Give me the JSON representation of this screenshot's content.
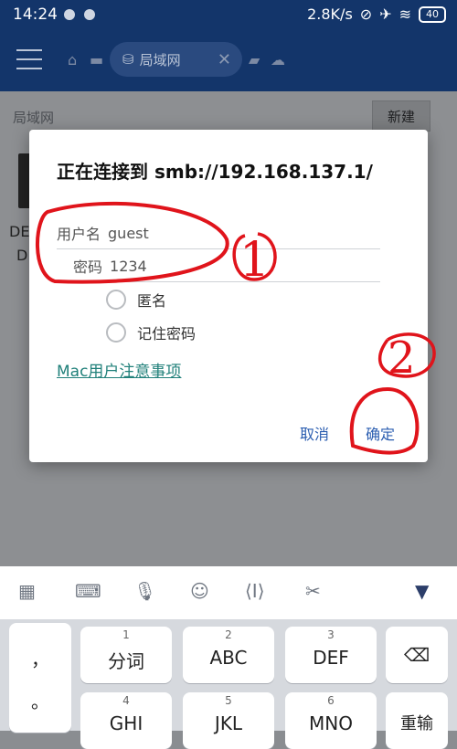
{
  "status_bar": {
    "time": "14:24",
    "network_speed": "2.8K/s",
    "battery_level": "40"
  },
  "header": {
    "tab_label": "局域网"
  },
  "page": {
    "breadcrumb": "局域网",
    "new_button": "新建",
    "bg_text_1": "DE",
    "bg_text_2": "D"
  },
  "dialog": {
    "title": "正在连接到 smb://192.168.137.1/",
    "username_label": "用户名",
    "username_value": "guest",
    "password_label": "密码",
    "password_value": "1234",
    "anonymous_label": "匿名",
    "remember_label": "记住密码",
    "mac_link": "Mac用户注意事项",
    "cancel_label": "取消",
    "ok_label": "确定"
  },
  "annotations": {
    "mark_1": "1",
    "mark_2": "2",
    "color": "#e0141b"
  },
  "keyboard": {
    "side_keys": [
      "，",
      "。"
    ],
    "keys_row1": [
      {
        "num": "1",
        "main": "分词"
      },
      {
        "num": "2",
        "main": "ABC"
      },
      {
        "num": "3",
        "main": "DEF"
      }
    ],
    "keys_row2": [
      {
        "num": "4",
        "main": "GHI"
      },
      {
        "num": "5",
        "main": "JKL"
      },
      {
        "num": "6",
        "main": "MNO"
      }
    ],
    "enter_label": "重输"
  },
  "colors": {
    "header_bg": "#13356a",
    "link": "#20807a",
    "button": "#2a5db0"
  }
}
